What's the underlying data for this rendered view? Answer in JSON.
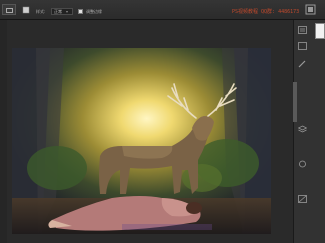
{
  "options_bar": {
    "tool_preset_icon": "marquee-tool-icon",
    "mode_label": "样式:",
    "style_value": "正常",
    "width_label": "宽度:",
    "checkbox_label": "调整边缘",
    "watermark": "PS视频教程 QQ群: 4486173"
  },
  "canvas_image": {
    "description_icon": "photo-layer"
  },
  "colors": {
    "ui_dark": "#2a2a2a",
    "ui_panel": "#323232",
    "watermark_red": "#c0492c"
  }
}
